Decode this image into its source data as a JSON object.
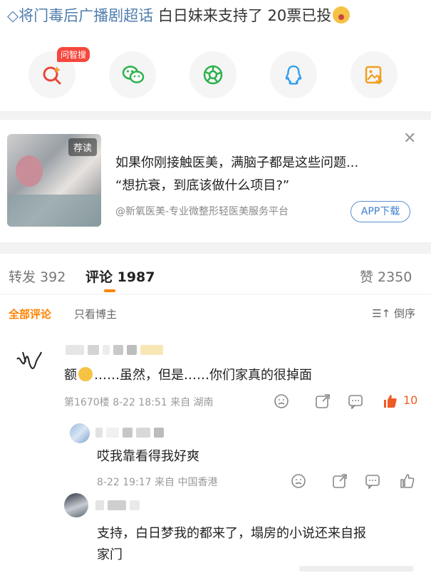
{
  "topic": {
    "prefix": "将门毒后广播剧超话",
    "text": "白日妹来支持了 20票已投"
  },
  "share": {
    "badge": "问智搜",
    "items": [
      "search",
      "wechat",
      "moments",
      "qq",
      "save-image"
    ]
  },
  "ad": {
    "tag": "荐读",
    "title": "如果你刚接触医美，满脑子都是这些问题...",
    "subtitle": "“想抗衰，到底该做什么项目?”",
    "source": "@新氧医美-专业微整形轻医美服务平台",
    "button": "APP下载"
  },
  "tabs": {
    "repost": "转发 392",
    "comments": "评论 1987",
    "likes": "赞 2350"
  },
  "filters": {
    "all": "全部评论",
    "author": "只看博主",
    "sort": "倒序"
  },
  "comments": [
    {
      "text_before": "额",
      "text_after": "……虽然，但是……你们家真的很掉面",
      "meta": "第1670楼 8-22 18:51 来自 湖南",
      "likes": "10"
    },
    {
      "text": "哎我靠看得我好爽",
      "meta": "8-22 19:17 来自 中国香港"
    },
    {
      "text_line1": "支持，白日梦我的都来了，塌房的小说还来自报",
      "text_line2": "家门"
    }
  ],
  "colors": {
    "accent": "#ff8200",
    "link": "#507daf",
    "meta": "#9a9a9a",
    "like": "#f05a24"
  }
}
